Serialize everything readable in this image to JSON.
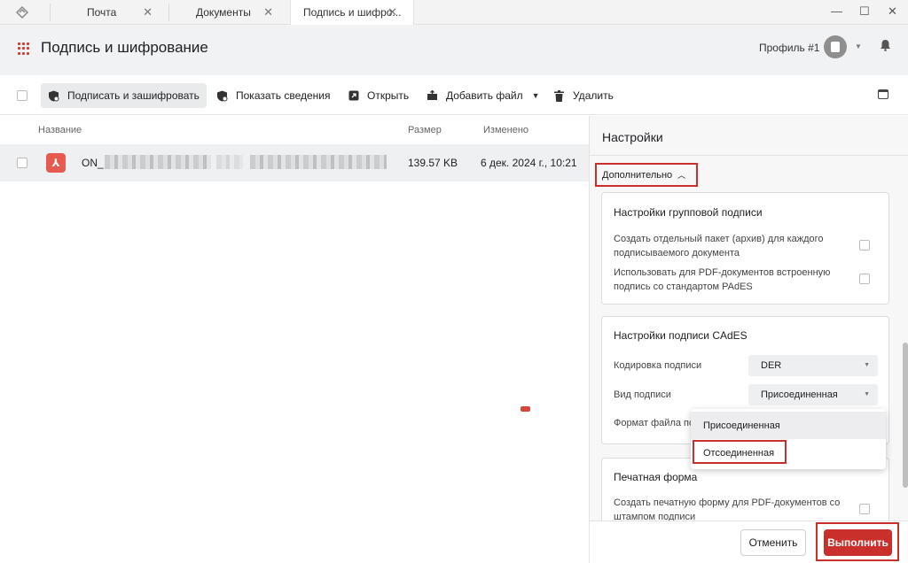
{
  "window_tabs": [
    {
      "label": "Почта"
    },
    {
      "label": "Документы"
    },
    {
      "label": "Подпись и шифро..."
    }
  ],
  "header": {
    "title": "Подпись и шифрование",
    "profile": "Профиль #1"
  },
  "toolbar": {
    "sign_encrypt": "Подписать и зашифровать",
    "show_info": "Показать сведения",
    "open": "Открыть",
    "add_file": "Добавить файл",
    "delete": "Удалить"
  },
  "file_table": {
    "columns": [
      "Название",
      "Размер",
      "Изменено"
    ],
    "rows": [
      {
        "name": "ON_",
        "size": "139.57 KB",
        "modified": "6 дек. 2024 г., 10:21"
      }
    ]
  },
  "settings": {
    "title": "Настройки",
    "advanced_toggle": "Дополнительно",
    "group_signature": {
      "title": "Настройки групповой подписи",
      "option_archive": "Создать отдельный пакет (архив) для каждого подписываемого документа",
      "option_pades": "Использовать для PDF-документов встроенную подпись со стандартом PAdES"
    },
    "cades": {
      "title": "Настройки подписи CAdES",
      "encoding_label": "Кодировка подписи",
      "encoding_value": "DER",
      "type_label": "Вид подписи",
      "type_value": "Присоединенная",
      "format_label": "Формат файла по"
    },
    "print_form": {
      "title": "Печатная форма",
      "option": "Создать печатную форму для PDF-документов со штампом подписи"
    }
  },
  "dropdown": {
    "options": [
      "Присоединенная",
      "Отсоединенная"
    ]
  },
  "footer": {
    "cancel": "Отменить",
    "run": "Выполнить"
  },
  "colors": {
    "accent": "#c9302c",
    "header_bg": "#f1f2f4",
    "selected_row": "#eef0f2"
  }
}
